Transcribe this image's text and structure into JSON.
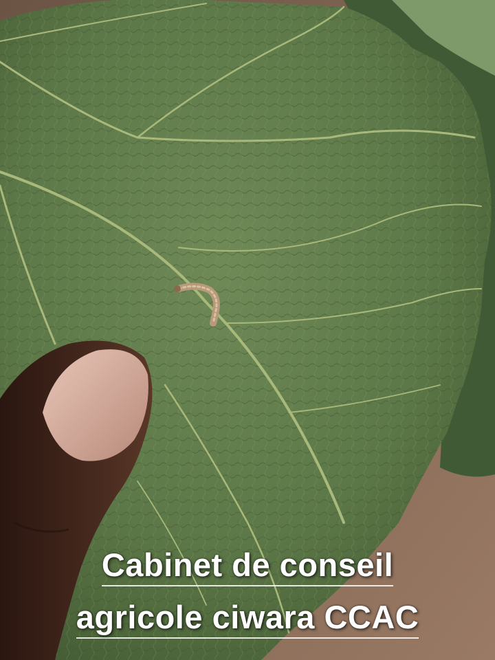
{
  "caption": {
    "line1": "Cabinet de conseil",
    "line2": "agricole ciwara CCAC"
  },
  "colors": {
    "leaf": "#5f7a4a",
    "leaf_vein": "#a8b87a",
    "soil": "#8a6a55",
    "thumb": "#3a2218",
    "nail": "#d8b0a2",
    "larva": "#b89a7a",
    "caption_text": "#ffffff"
  },
  "scene": {
    "subject": "caterpillar-larva",
    "background": "leaf-over-soil"
  }
}
